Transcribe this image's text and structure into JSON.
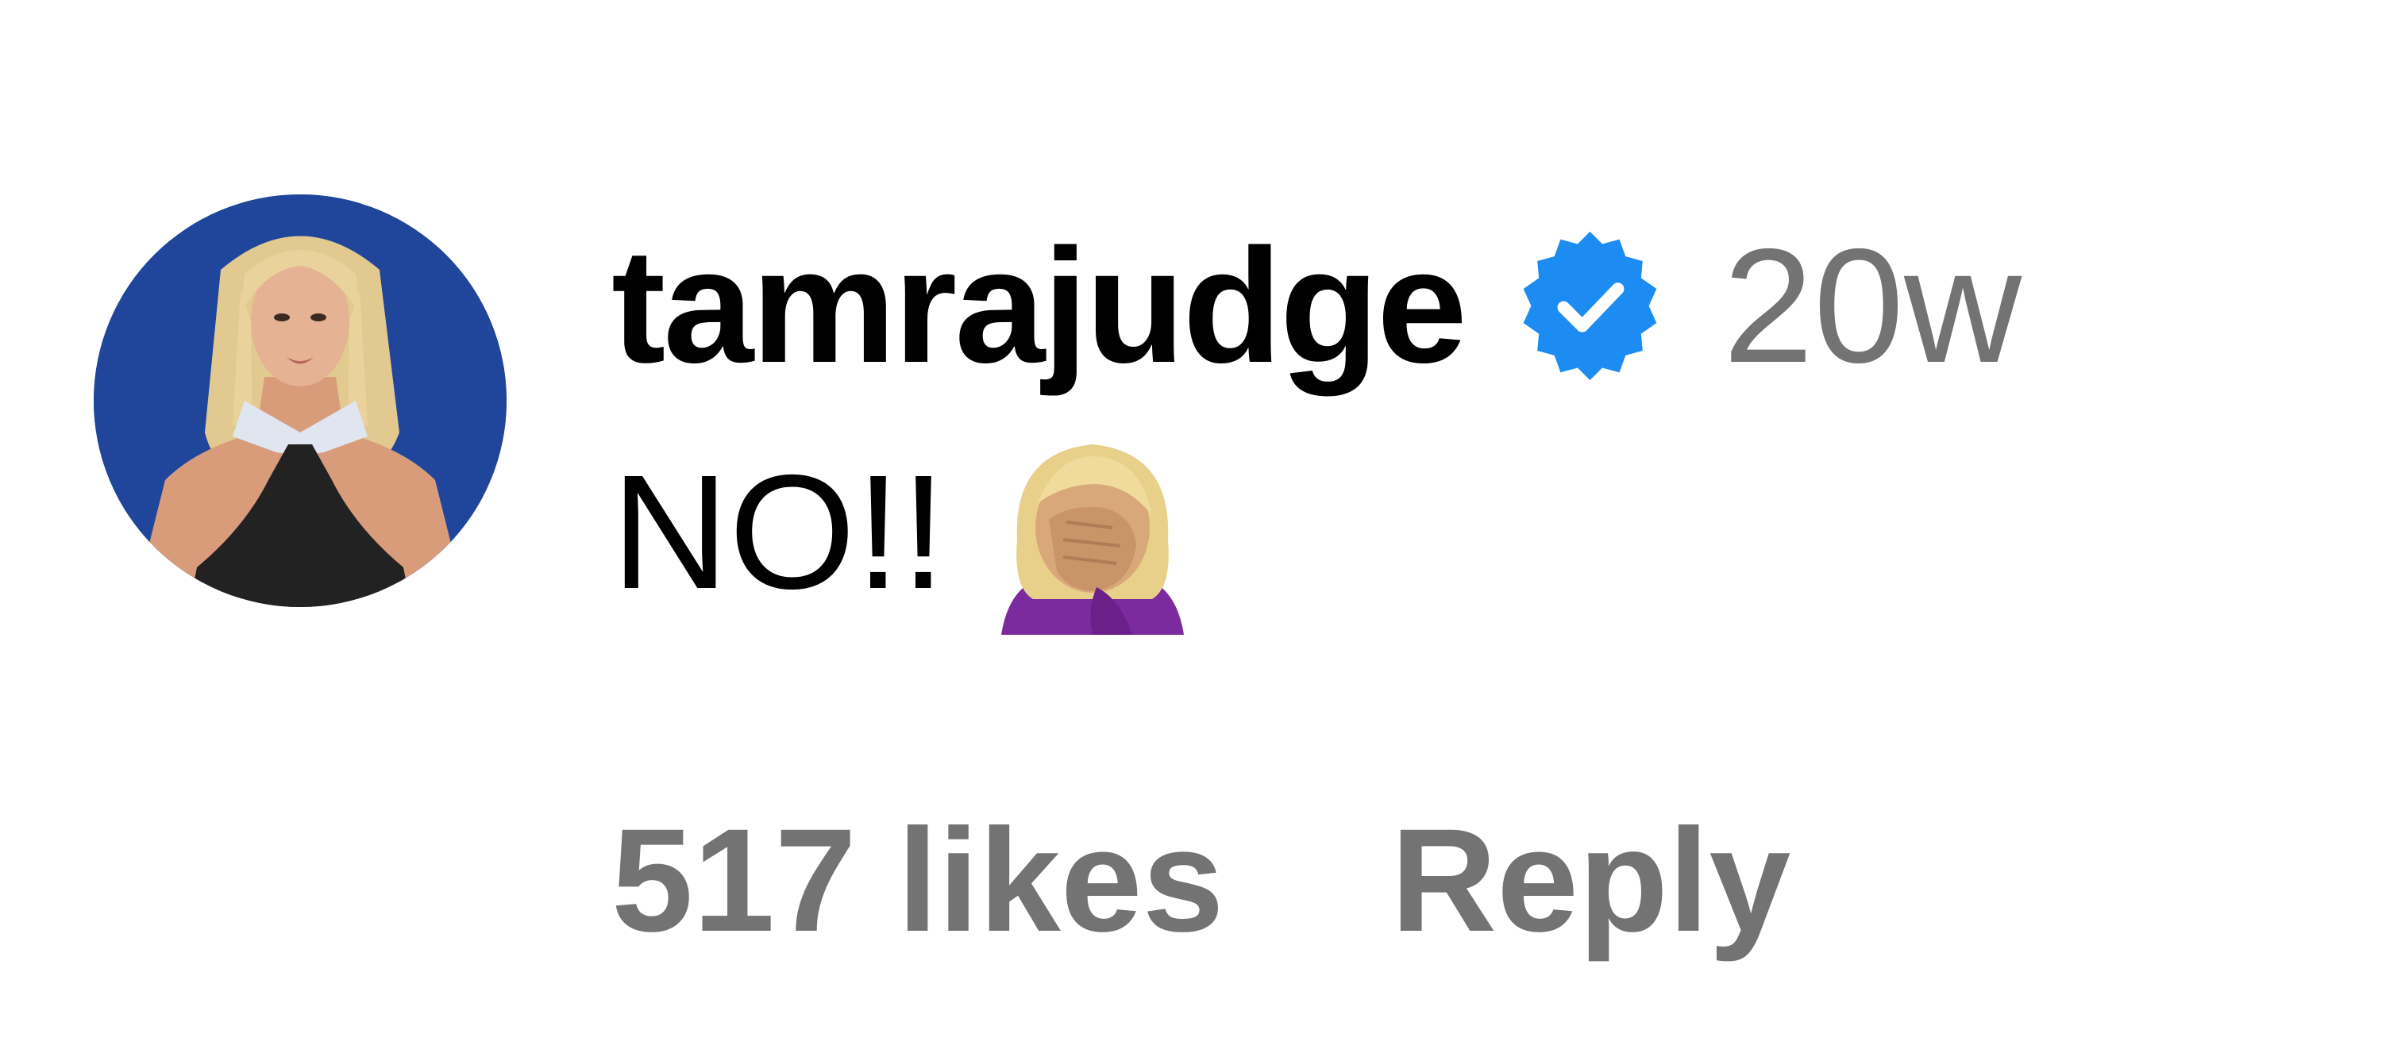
{
  "comment": {
    "username": "tamrajudge",
    "verified": true,
    "timestamp": "20w",
    "text": "NO!!",
    "emoji": "woman-facepalming-icon",
    "likes": "517 likes",
    "reply_label": "Reply"
  },
  "colors": {
    "verified_badge": "#1d8cf2",
    "secondary_text": "#737373",
    "primary_text": "#000000",
    "avatar_background": "#20469b"
  }
}
